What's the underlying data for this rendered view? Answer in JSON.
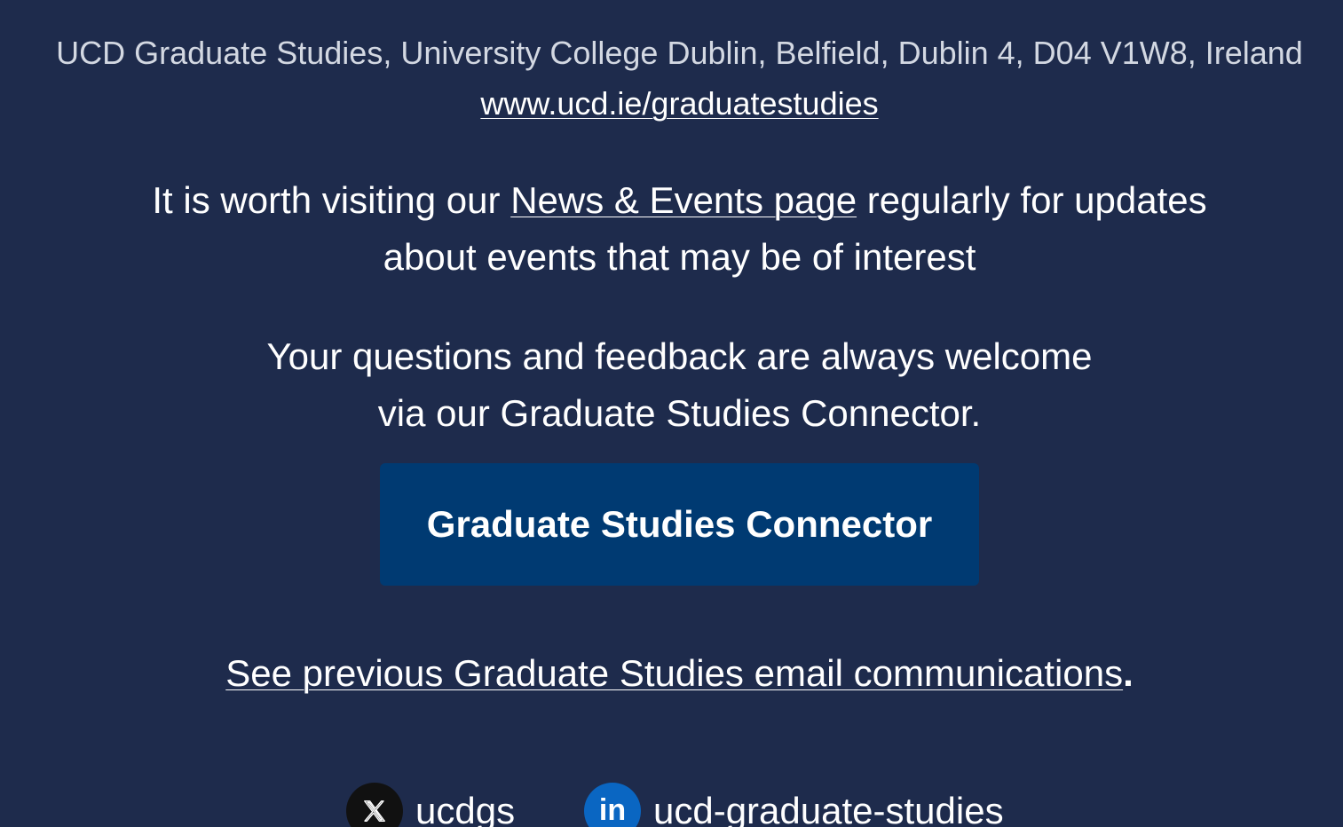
{
  "footer": {
    "address": "UCD Graduate Studies, University College Dublin, Belfield, Dublin 4, D04 V1W8, Ireland",
    "website": "www.ucd.ie/graduatestudies",
    "news_prefix": "It is worth visiting our ",
    "news_link": "News & Events page",
    "news_suffix_line1": " regular​ly for updates",
    "news_line2": "about events that may be of interest",
    "feedback_line1": "Your questions and feedback are always welcome",
    "feedback_line2": "via our Graduate Studies Connector.",
    "cta_label": "Graduate Studies Connector",
    "previous_link": "See previous Graduate Studies email communications",
    "previous_dot": ".",
    "social": {
      "x_handle": "ucdgs",
      "x_icon": "x-logo-icon",
      "linkedin_handle": "ucd-graduate-studies",
      "linkedin_icon": "linkedin-icon",
      "linkedin_glyph": "in"
    },
    "colors": {
      "background": "#1e2b4c",
      "button": "#003a72",
      "linkedin": "#0a66c2"
    }
  }
}
